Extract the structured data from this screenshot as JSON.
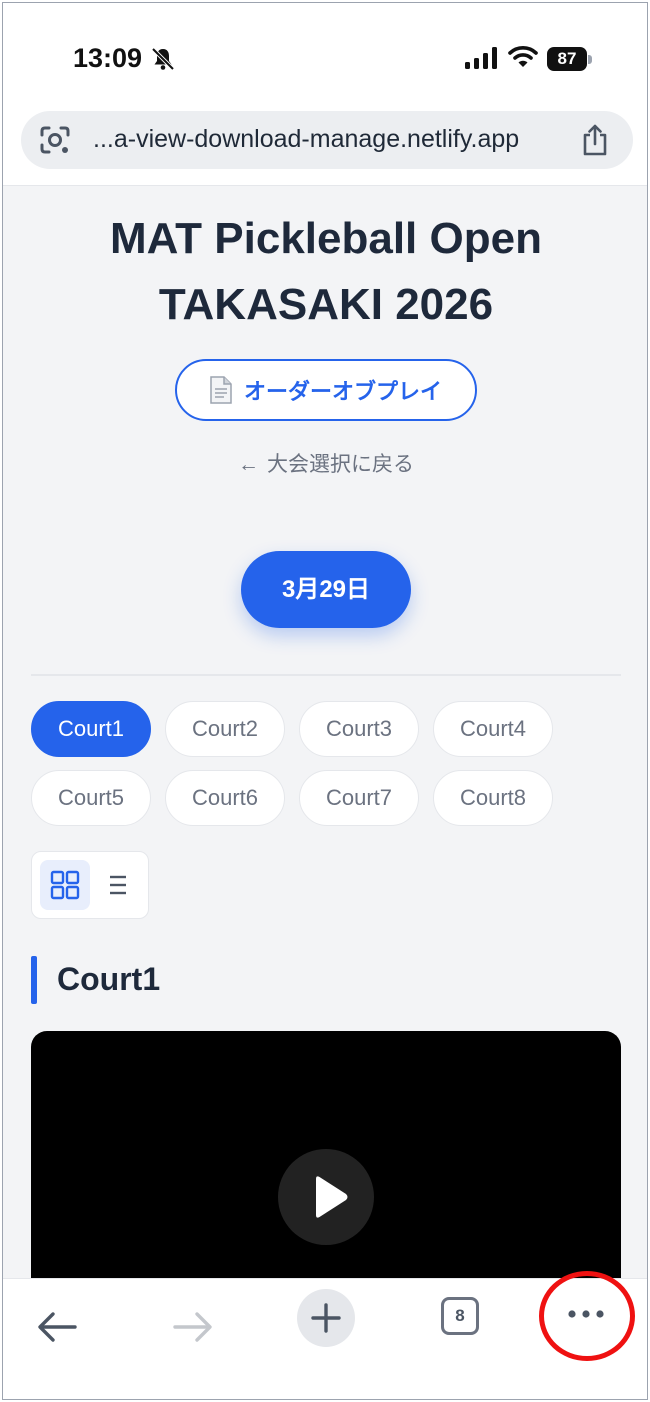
{
  "status_bar": {
    "time": "13:09",
    "battery": "87"
  },
  "browser": {
    "url": "...a-view-download-manage.netlify.app",
    "tab_count": "8"
  },
  "page": {
    "title_line1": "MAT Pickleball Open",
    "title_line2": "TAKASAKI 2026",
    "order_button_label": "オーダーオブプレイ",
    "back_arrow": "←",
    "back_label": "大会選択に戻る",
    "date_label": "3月29日",
    "courts": [
      "Court1",
      "Court2",
      "Court3",
      "Court4",
      "Court5",
      "Court6",
      "Court7",
      "Court8"
    ],
    "active_court": "Court1",
    "section_title": "Court1"
  },
  "colors": {
    "accent": "#2563eb",
    "page_bg": "#f3f4f6",
    "highlight": "#ef1111"
  },
  "icons": {
    "status": [
      "bell-slash-icon",
      "signal-icon",
      "wifi-icon",
      "battery-icon"
    ],
    "urlbar": [
      "lens-icon",
      "share-icon"
    ],
    "toolbar": [
      "back-arrow-icon",
      "forward-arrow-icon",
      "plus-icon",
      "tabs-icon",
      "more-icon"
    ],
    "view_toggle": [
      "grid-view-icon",
      "list-view-icon"
    ]
  }
}
